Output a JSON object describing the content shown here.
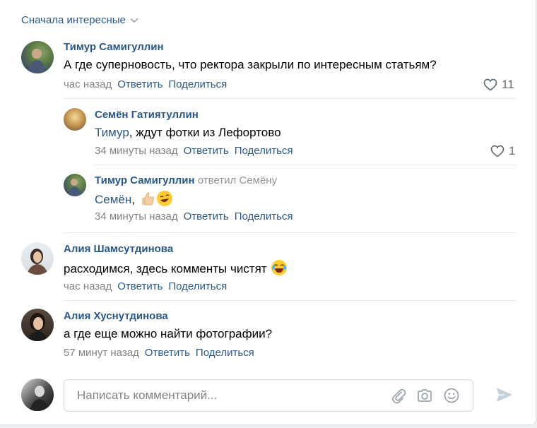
{
  "sort": {
    "label": "Сначала интересные",
    "icon": "chevron-down-icon"
  },
  "comments": [
    {
      "author": "Тимур Самигуллин",
      "text": "А где суперновость, что ректора закрыли по интересным статьям?",
      "time": "час назад",
      "reply_label": "Ответить",
      "share_label": "Поделиться",
      "likes": "11"
    },
    {
      "author": "Семён Гатиятуллин",
      "mention": "Тимур",
      "text": ", ждут фотки из Лефортово",
      "time": "34 минуты назад",
      "reply_label": "Ответить",
      "share_label": "Поделиться",
      "likes": "1"
    },
    {
      "author": "Тимур Самигуллин",
      "replied_to": "ответил Семёну",
      "mention": "Семён",
      "text": ",",
      "emojis": [
        "thumbs-up-emoji",
        "rolling-laughing-emoji"
      ],
      "time": "34 минуты назад",
      "reply_label": "Ответить",
      "share_label": "Поделиться"
    },
    {
      "author": "Алия Шамсутдинова",
      "text": "расходимся, здесь комменты чистят",
      "emojis": [
        "joy-emoji"
      ],
      "time": "час назад",
      "reply_label": "Ответить",
      "share_label": "Поделиться"
    },
    {
      "author": "Алия Хуснутдинова",
      "text": "а где еще можно найти фотографии?",
      "time": "57 минут назад",
      "reply_label": "Ответить",
      "share_label": "Поделиться"
    }
  ],
  "composer": {
    "placeholder": "Написать комментарий...",
    "icons": [
      "paperclip-icon",
      "camera-icon",
      "smiley-icon",
      "send-icon"
    ]
  },
  "colors": {
    "link": "#2a5885",
    "meta": "#828282",
    "like": "#626d7a",
    "divider": "#e7e8ec"
  }
}
